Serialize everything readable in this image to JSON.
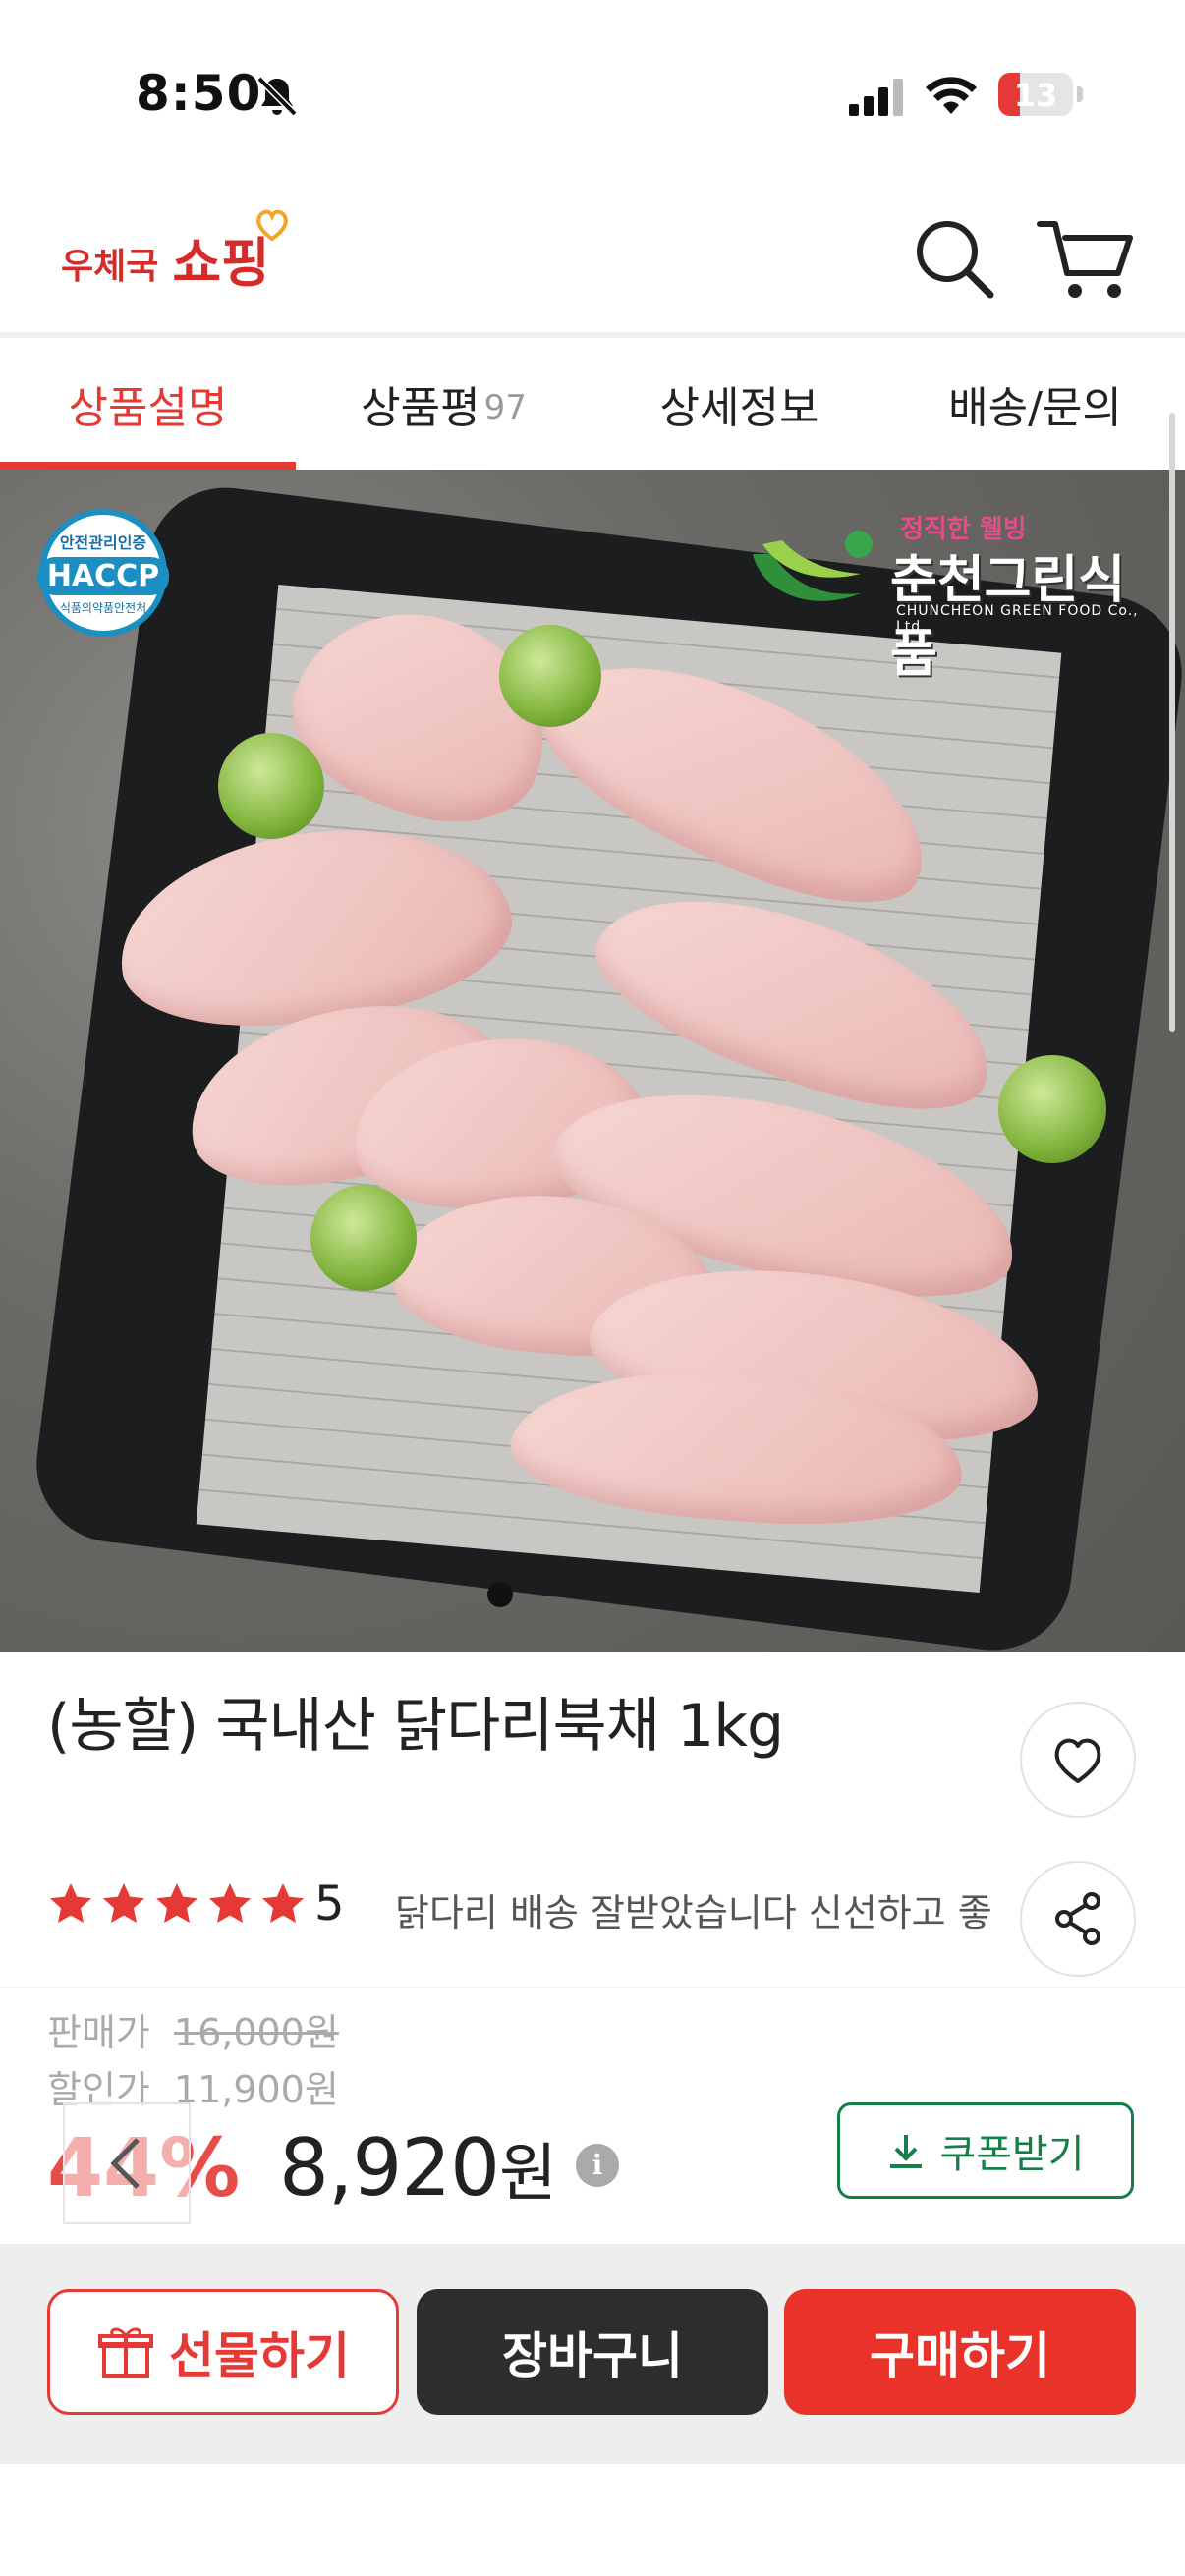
{
  "status_bar": {
    "time": "8:50",
    "battery": "13",
    "battery_color": "#e53935"
  },
  "header": {
    "logo_prefix": "우체국",
    "logo_main": "쇼핑",
    "search_icon": "search-icon",
    "cart_icon": "cart-icon"
  },
  "tabs": [
    {
      "label": "상품설명",
      "count": "",
      "active": true
    },
    {
      "label": "상품평",
      "count": "97",
      "active": false
    },
    {
      "label": "상세정보",
      "count": "",
      "active": false
    },
    {
      "label": "배송/문의",
      "count": "",
      "active": false
    }
  ],
  "hero": {
    "haccp_top": "안전관리인증",
    "haccp_mark": "HACCP",
    "haccp_bottom": "식품의약품안전처",
    "brand_tag": "정직한 웰빙",
    "brand_name": "춘천그린식품",
    "brand_en": "CHUNCHEON GREEN FOOD Co., Ltd."
  },
  "product": {
    "title": "(농할) 국내산 닭다리북채 1kg",
    "stars": 5,
    "rating": "5",
    "review_snippet": "닭다리 배송 잘받았습니다 신선하고 좋아"
  },
  "price": {
    "sale_label": "판매가",
    "sale_price": "16,000원",
    "discount_label": "할인가",
    "discount_price": "11,900원",
    "discount_rate": "44%",
    "final_price_number": "8,920",
    "final_price_unit": "원",
    "info": "i",
    "coupon_label": "쿠폰받기"
  },
  "actions": {
    "gift": "선물하기",
    "cart": "장바구니",
    "buy": "구매하기"
  },
  "colors": {
    "accent": "#e53935",
    "coupon": "#157f47",
    "dark": "#2d2d2d"
  }
}
